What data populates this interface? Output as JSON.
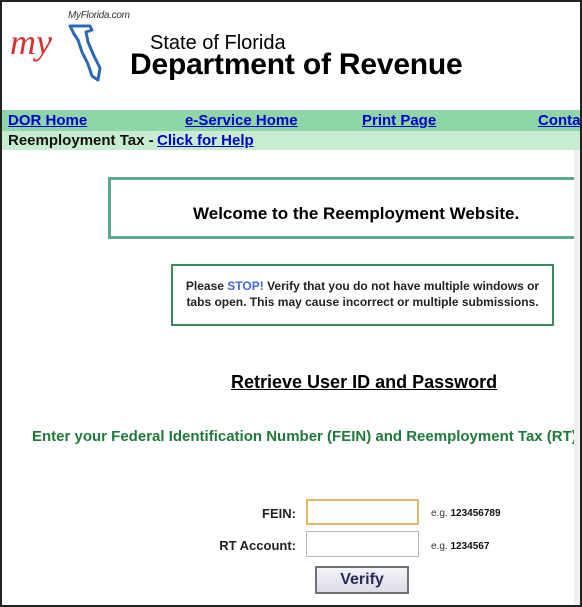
{
  "branding": {
    "myflorida": "MyFlorida.com",
    "my": "my",
    "state_line": "State of Florida",
    "dept_line": "Department of Revenue"
  },
  "nav": {
    "dor_home": "DOR Home",
    "eservice_home": "e-Service Home",
    "print_page": "Print Page",
    "contact": "Conta"
  },
  "subnav": {
    "label": "Reemployment Tax -",
    "help_link": "Click for Help"
  },
  "welcome": "Welcome to the Reemployment Website.",
  "warning": {
    "please": "Please",
    "stop": "STOP!",
    "line1_rest": "Verify that you do not have multiple windows or",
    "line2": "tabs open. This may cause incorrect or multiple submissions."
  },
  "retrieve_title": "Retrieve User ID and Password",
  "instruction": "Enter your Federal Identification Number (FEIN) and Reemployment Tax (RT) A",
  "form": {
    "fein_label": "FEIN:",
    "fein_value": "",
    "fein_hint_prefix": "e.g.",
    "fein_hint": "123456789",
    "rt_label": "RT Account:",
    "rt_value": "",
    "rt_hint_prefix": "e.g.",
    "rt_hint": "1234567",
    "verify_label": "Verify"
  },
  "colors": {
    "nav_bar": "#8ed6a8",
    "sub_bar": "#c8eccf",
    "link": "#0000cc",
    "instruction": "#1f7a3a",
    "box_border": "#5aa888"
  }
}
